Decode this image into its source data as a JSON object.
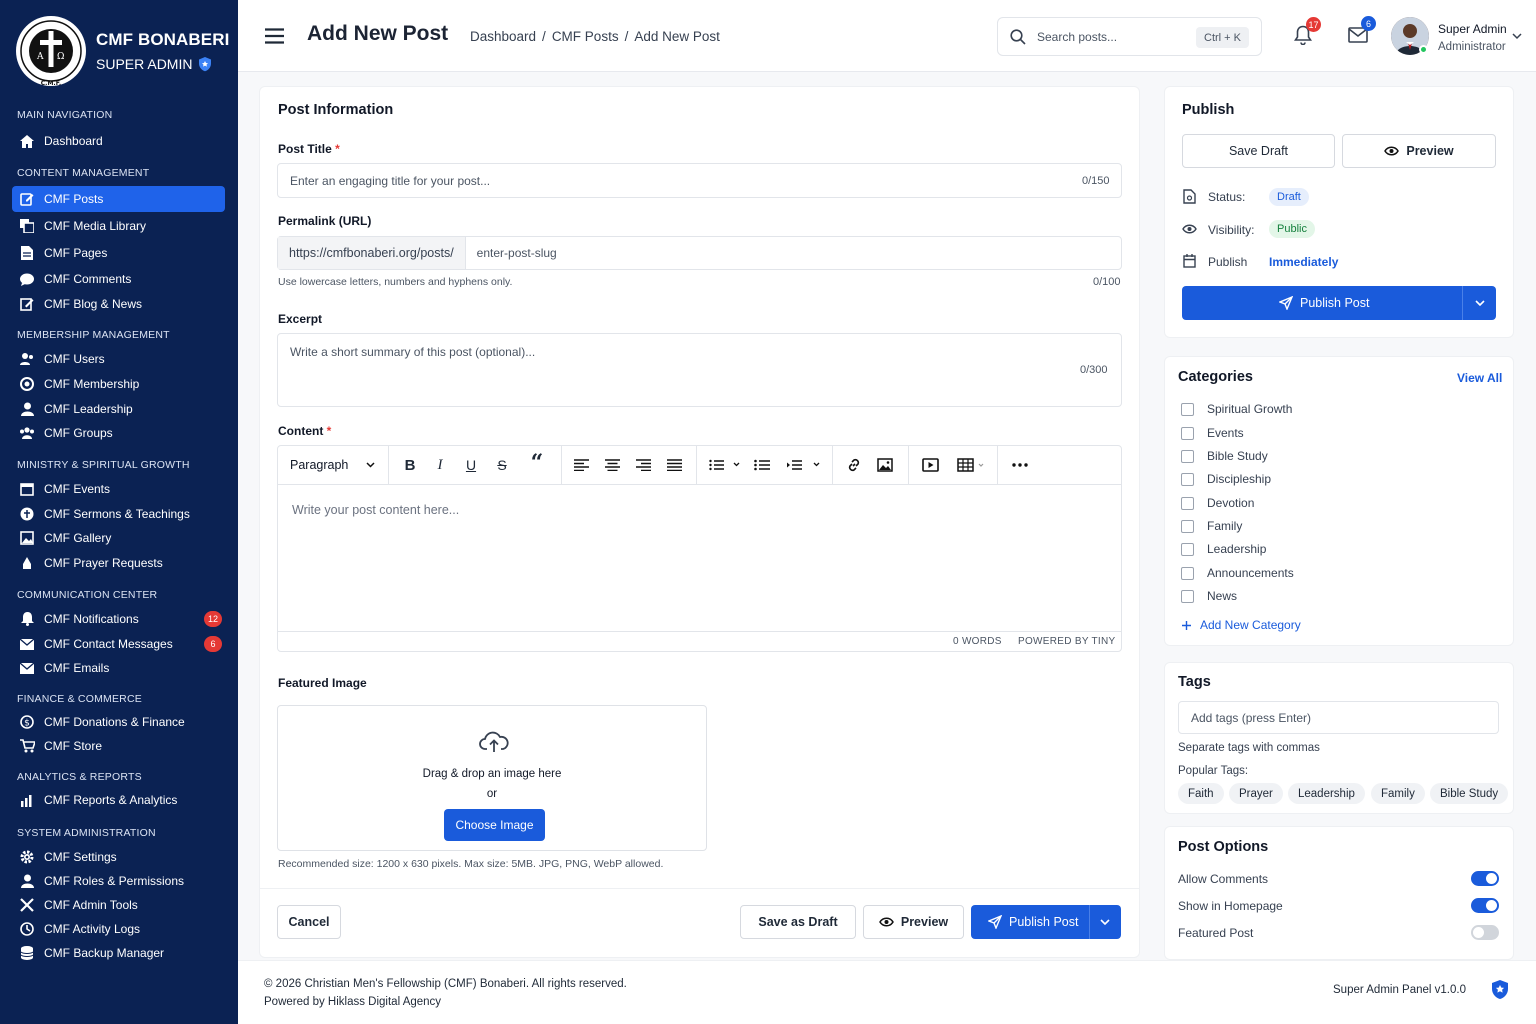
{
  "brand": {
    "title": "CMF BONABERI",
    "subtitle": "SUPER ADMIN",
    "logo_text": "CHRISTIAN MEN'S FELLOWSHIP C.M.F."
  },
  "sidebar": {
    "sections": {
      "main": "MAIN NAVIGATION",
      "content": "CONTENT MANAGEMENT",
      "membership": "MEMBERSHIP MANAGEMENT",
      "ministry": "MINISTRY & SPIRITUAL GROWTH",
      "communication": "COMMUNICATION CENTER",
      "finance": "FINANCE & COMMERCE",
      "analytics": "ANALYTICS & REPORTS",
      "system": "SYSTEM ADMINISTRATION"
    },
    "items": {
      "dashboard": "Dashboard",
      "posts": "CMF Posts",
      "media": "CMF Media Library",
      "pages": "CMF Pages",
      "comments": "CMF Comments",
      "blog": "CMF Blog & News",
      "users": "CMF Users",
      "membership": "CMF Membership",
      "leadership": "CMF Leadership",
      "groups": "CMF Groups",
      "events": "CMF Events",
      "sermons": "CMF Sermons & Teachings",
      "gallery": "CMF Gallery",
      "prayer": "CMF Prayer Requests",
      "notifications": "CMF Notifications",
      "contact": "CMF Contact Messages",
      "emails": "CMF Emails",
      "donations": "CMF Donations & Finance",
      "store": "CMF Store",
      "reports": "CMF Reports & Analytics",
      "settings": "CMF Settings",
      "roles": "CMF Roles & Permissions",
      "tools": "CMF Admin Tools",
      "logs": "CMF Activity Logs",
      "backup": "CMF Backup Manager"
    },
    "badges": {
      "notifications": "12",
      "contact": "6"
    }
  },
  "header": {
    "title": "Add New Post",
    "breadcrumb": [
      "Dashboard",
      "/",
      "CMF Posts",
      "/",
      "Add New Post"
    ],
    "search_placeholder": "Search posts...",
    "search_shortcut": "Ctrl + K",
    "notifications_count": "17",
    "messages_count": "6",
    "user_name": "Super Admin",
    "user_role": "Administrator"
  },
  "post_info": {
    "heading": "Post Information",
    "title_label": "Post Title",
    "required_mark": "*",
    "title_placeholder": "Enter an engaging title for your post...",
    "title_count": "0/150",
    "permalink_label": "Permalink (URL)",
    "permalink_prefix": "https://cmfbonaberi.org/posts/",
    "permalink_placeholder": "enter-post-slug",
    "permalink_hint": "Use lowercase letters, numbers and hyphens only.",
    "permalink_count": "0/100",
    "excerpt_label": "Excerpt",
    "excerpt_placeholder": "Write a short summary of this post (optional)...",
    "excerpt_count": "0/300",
    "content_label": "Content",
    "format_select": "Paragraph",
    "content_placeholder": "Write your post content here...",
    "word_count": "0 WORDS",
    "powered_by": "POWERED BY TINY",
    "featured_label": "Featured Image",
    "drop_text": "Drag & drop an image here",
    "or_text": "or",
    "choose_button": "Choose Image",
    "image_hint": "Recommended size: 1200 x 630 pixels. Max size: 5MB. JPG, PNG, WebP allowed."
  },
  "form_actions": {
    "cancel": "Cancel",
    "save_draft": "Save as Draft",
    "preview": "Preview",
    "publish": "Publish Post"
  },
  "publish_box": {
    "heading": "Publish",
    "save_draft": "Save Draft",
    "preview": "Preview",
    "status_label": "Status:",
    "status_value": "Draft",
    "visibility_label": "Visibility:",
    "visibility_value": "Public",
    "publish_label": "Publish",
    "publish_value": "Immediately",
    "publish_button": "Publish Post"
  },
  "categories": {
    "heading": "Categories",
    "view_all": "View All",
    "items": [
      "Spiritual Growth",
      "Events",
      "Bible Study",
      "Discipleship",
      "Devotion",
      "Family",
      "Leadership",
      "Announcements",
      "News"
    ],
    "add_new": "Add New Category"
  },
  "tags": {
    "heading": "Tags",
    "placeholder": "Add tags (press Enter)",
    "hint": "Separate tags with commas",
    "popular_label": "Popular Tags:",
    "popular": [
      "Faith",
      "Prayer",
      "Leadership",
      "Family",
      "Bible Study"
    ]
  },
  "post_options": {
    "heading": "Post Options",
    "allow_comments": "Allow Comments",
    "allow_comments_on": true,
    "show_homepage": "Show in Homepage",
    "show_homepage_on": true,
    "featured": "Featured Post",
    "featured_on": false
  },
  "footer": {
    "copyright": "© 2026 Christian Men's Fellowship (CMF) Bonaberi. All rights reserved.",
    "powered": "Powered by Hiklass Digital Agency",
    "version": "Super Admin Panel v1.0.0"
  },
  "colors": {
    "sidebar": "#0b2253",
    "accent": "#1a5bdb",
    "badge_red": "#e53935",
    "status_draft_bg": "#e6eefc",
    "status_public_bg": "#e3f6e8"
  }
}
